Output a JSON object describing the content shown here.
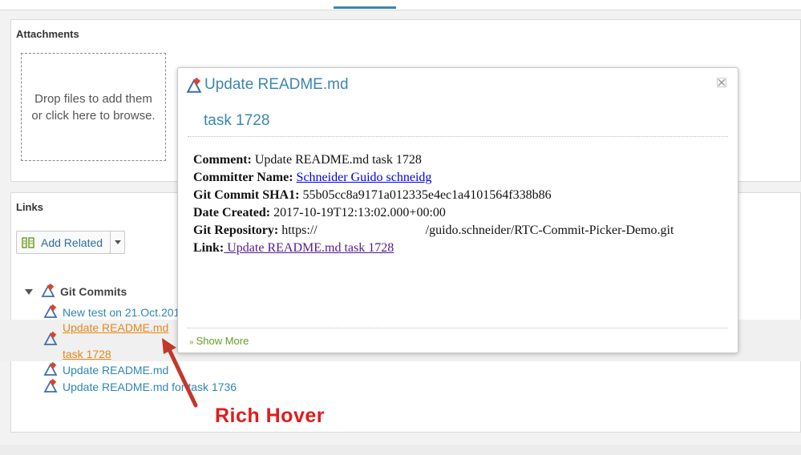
{
  "attachments": {
    "title": "Attachments",
    "dropzone_text": "Drop files to add them or click here to browse."
  },
  "links": {
    "title": "Links",
    "add_related_label": "Add Related",
    "group_label": "Git Commits",
    "items": [
      {
        "label": "New test on 21.Oct.201"
      },
      {
        "label": "Update README.md",
        "label_2": "task 1728"
      },
      {
        "label": "Update README.md"
      },
      {
        "label": "Update README.md for task 1736"
      }
    ]
  },
  "popup": {
    "title": "Update README.md",
    "subtitle": "task 1728",
    "fields": {
      "comment_label": "Comment:",
      "comment_value": "Update README.md task 1728",
      "committer_label": "Committer Name:",
      "committer_value": "Schneider Guido schneidg",
      "sha_label": "Git Commit SHA1:",
      "sha_value": "55b05cc8a9171a012335e4ec1a4101564f338b86",
      "date_label": "Date Created:",
      "date_value": "2017-10-19T12:13:02.000+00:00",
      "repo_label": "Git Repository:",
      "repo_prefix": "https://",
      "repo_suffix": "/guido.schneider/RTC-Commit-Picker-Demo.git",
      "link_label": "Link:",
      "link_value": " Update README.md task 1728"
    },
    "show_more": "Show More"
  },
  "annotation": {
    "text": "Rich Hover",
    "color": "#e21b1b"
  },
  "colors": {
    "accent": "#3b86b0",
    "link": "#2f86b5",
    "hover_link": "#e48a1a",
    "show_more": "#6a9a1f"
  }
}
